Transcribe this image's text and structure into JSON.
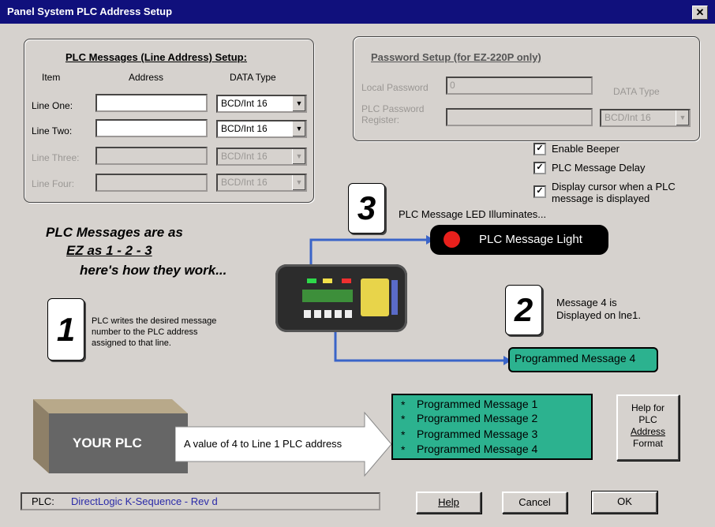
{
  "window": {
    "title": "Panel System PLC Address Setup",
    "close": "✕"
  },
  "plc_group": {
    "title": "PLC Messages (Line Address) Setup:",
    "col_item": "Item",
    "col_address": "Address",
    "col_datatype": "DATA Type",
    "lines": [
      {
        "label": "Line One:",
        "value": "",
        "type": "BCD/Int 16",
        "enabled": true
      },
      {
        "label": "Line Two:",
        "value": "",
        "type": "BCD/Int 16",
        "enabled": true
      },
      {
        "label": "Line Three:",
        "value": "",
        "type": "BCD/Int 16",
        "enabled": false
      },
      {
        "label": "Line Four:",
        "value": "",
        "type": "BCD/Int 16",
        "enabled": false
      }
    ]
  },
  "password_group": {
    "title": "Password Setup (for EZ-220P only)",
    "local_label": "Local Password",
    "local_value": "0",
    "plc_label_1": "PLC Password",
    "plc_label_2": "Register:",
    "datatype_label": "DATA Type",
    "datatype_value": "BCD/Int 16"
  },
  "options": {
    "enable_beeper": "Enable Beeper",
    "msg_delay": "PLC Message Delay",
    "cursor_1": "Display cursor when a PLC",
    "cursor_2": "message is displayed",
    "check": "✓"
  },
  "illustration": {
    "headline_1": "PLC Messages are as",
    "headline_2": "EZ as 1 - 2 - 3",
    "headline_3": "here's how they work...",
    "step1_num": "1",
    "step1_text_1": "PLC writes the desired message",
    "step1_text_2": "number to the PLC address",
    "step1_text_3": "assigned to that line.",
    "step2_num": "2",
    "step2_text_1": "Message 4 is",
    "step2_text_2": "Displayed on lne1.",
    "step3_num": "3",
    "step3_text": "PLC Message LED Illuminates...",
    "light_label": "PLC Message Light",
    "programmed_msg": "Programmed Message 4",
    "plc_box": "YOUR PLC",
    "arrow_text": "A value of 4 to Line 1 PLC address",
    "msg_list": [
      "Programmed Message 1",
      "Programmed Message 2",
      "Programmed Message 3",
      "Programmed Message 4"
    ],
    "bullet": "*"
  },
  "help_format": {
    "l1": "Help for",
    "l2": "PLC",
    "l3": "Address",
    "l4": "Format"
  },
  "status": {
    "label": "PLC:",
    "value": "DirectLogic K-Sequence - Rev d"
  },
  "buttons": {
    "help": "Help",
    "cancel": "Cancel",
    "ok": "OK"
  },
  "colors": {
    "title_bg": "#10107c",
    "teal": "#2cb28f",
    "led": "#e8201c",
    "arrow": "#3a64c8"
  }
}
